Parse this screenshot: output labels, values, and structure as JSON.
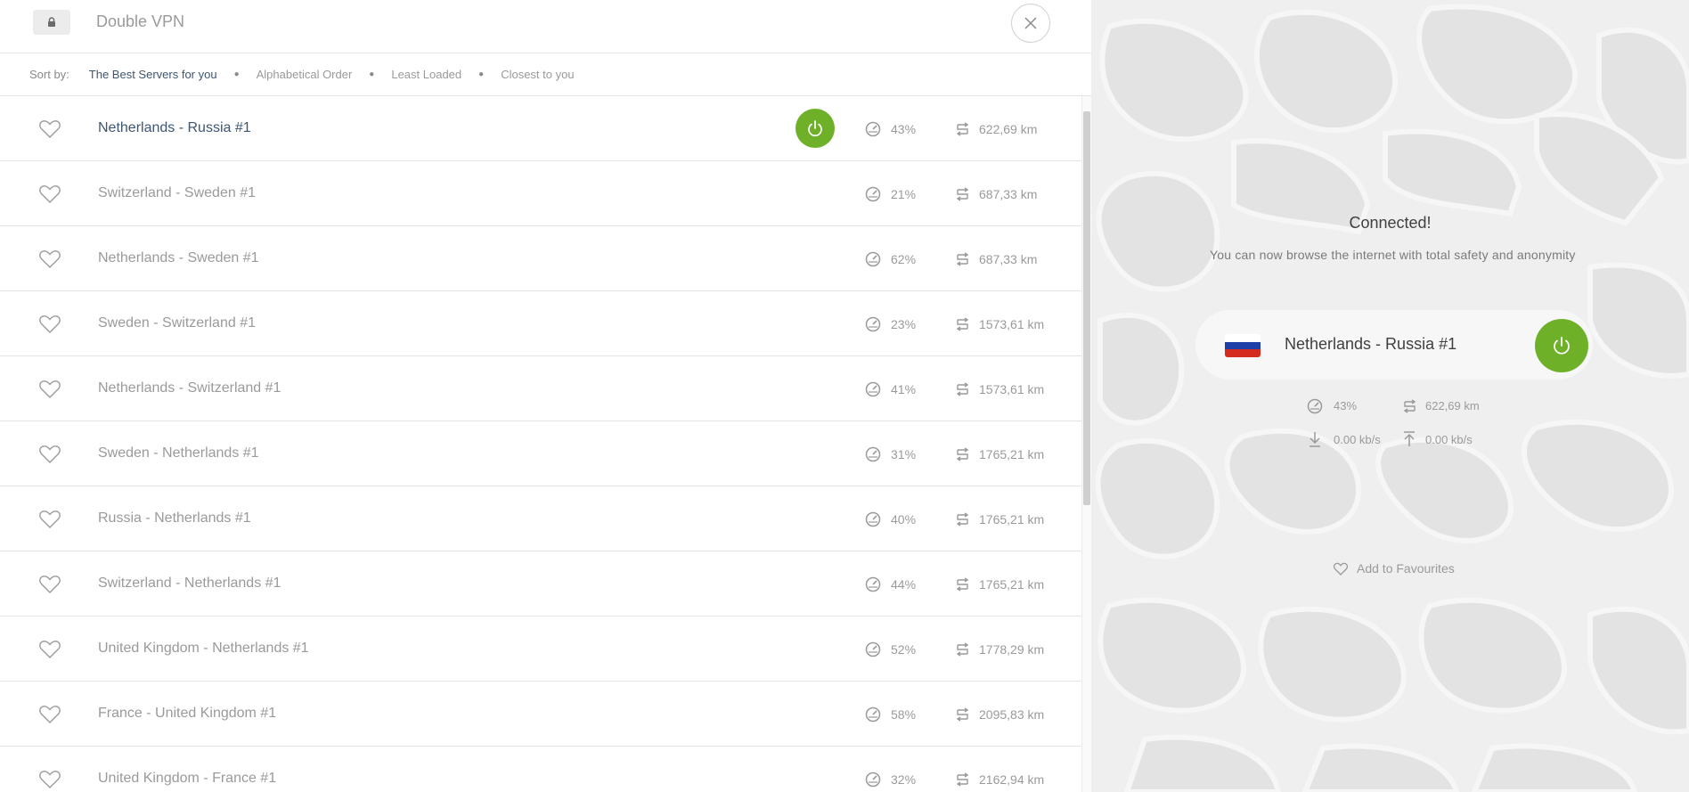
{
  "header": {
    "title": "Double VPN",
    "lock_icon": "lock-icon",
    "close_icon": "close-icon"
  },
  "sort": {
    "label": "Sort by:",
    "options": [
      {
        "label": "The Best Servers for you",
        "active": true
      },
      {
        "label": "Alphabetical Order",
        "active": false
      },
      {
        "label": "Least Loaded",
        "active": false
      },
      {
        "label": "Closest to you",
        "active": false
      }
    ]
  },
  "servers": [
    {
      "name": "Netherlands - Russia #1",
      "load": "43%",
      "distance": "622,69 km",
      "connected": true
    },
    {
      "name": "Switzerland - Sweden #1",
      "load": "21%",
      "distance": "687,33 km",
      "connected": false
    },
    {
      "name": "Netherlands - Sweden #1",
      "load": "62%",
      "distance": "687,33 km",
      "connected": false
    },
    {
      "name": "Sweden - Switzerland #1",
      "load": "23%",
      "distance": "1573,61 km",
      "connected": false
    },
    {
      "name": "Netherlands - Switzerland #1",
      "load": "41%",
      "distance": "1573,61 km",
      "connected": false
    },
    {
      "name": "Sweden - Netherlands #1",
      "load": "31%",
      "distance": "1765,21 km",
      "connected": false
    },
    {
      "name": "Russia - Netherlands #1",
      "load": "40%",
      "distance": "1765,21 km",
      "connected": false
    },
    {
      "name": "Switzerland - Netherlands #1",
      "load": "44%",
      "distance": "1765,21 km",
      "connected": false
    },
    {
      "name": "United Kingdom - Netherlands #1",
      "load": "52%",
      "distance": "1778,29 km",
      "connected": false
    },
    {
      "name": "France - United Kingdom #1",
      "load": "58%",
      "distance": "2095,83 km",
      "connected": false
    },
    {
      "name": "United Kingdom - France #1",
      "load": "32%",
      "distance": "2162,94 km",
      "connected": false
    }
  ],
  "status": {
    "title": "Connected!",
    "subtitle": "You can now browse the internet with total safety and anonymity",
    "server_name": "Netherlands - Russia #1",
    "flag_colors": [
      "#ffffff",
      "#1f3fa8",
      "#d52b1e"
    ],
    "load": "43%",
    "distance": "622,69 km",
    "download": "0.00 kb/s",
    "upload": "0.00 kb/s",
    "favourite_label": "Add to Favourites"
  },
  "colors": {
    "accent_green": "#6eb128",
    "active_text": "#3e5670"
  }
}
